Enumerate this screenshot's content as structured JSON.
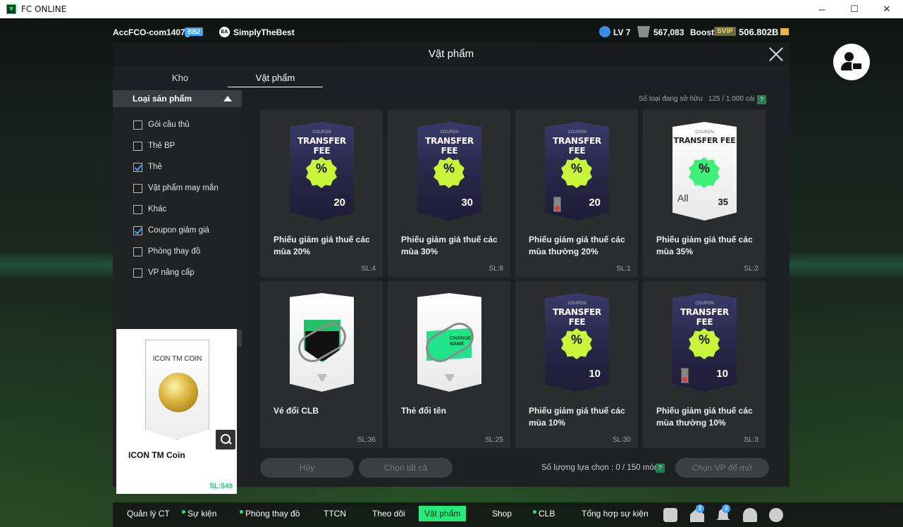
{
  "window": {
    "title": "FC ONLINE",
    "minimize": "─",
    "maximize": "☐",
    "close": "✕"
  },
  "topbar": {
    "account": "AccFCO-com1407g",
    "account_badge": "BB2",
    "ea_label": "EA",
    "team": "SimplyTheBest",
    "level": "LV 7",
    "coins": "567,083",
    "boost_label": "Boost",
    "svip": "SVIP",
    "bp": "506.802B"
  },
  "panel": {
    "title": "Vật phẩm",
    "tabs": [
      {
        "label": "Kho"
      },
      {
        "label": "Vật phẩm"
      }
    ],
    "category_header": "Loại sản phẩm",
    "categories": [
      {
        "label": "Gói cầu thủ",
        "checked": false
      },
      {
        "label": "Thẻ BP",
        "checked": false
      },
      {
        "label": "Thẻ",
        "checked": true
      },
      {
        "label": "Vật phẩm may mắn",
        "checked": false
      },
      {
        "label": "Khác",
        "checked": false
      },
      {
        "label": "Coupon giảm giá",
        "checked": true
      },
      {
        "label": "Phòng thay đồ",
        "checked": false
      },
      {
        "label": "VP nâng cấp",
        "checked": false
      }
    ],
    "detail": {
      "card_title": "ICON TM COIN",
      "name": "ICON TM Coin",
      "qty": "SL:549"
    },
    "count_label": "Số loại đang sở hữu",
    "count_value": "125 / 1.000 cái",
    "help": "?",
    "items": [
      {
        "name": "Phiếu giảm giá thuế các mùa 20%",
        "qty": "SL:4",
        "card": "coupon",
        "small": "COUPON",
        "title": "TRANSFER FEE",
        "pct": "20",
        "restricted": false
      },
      {
        "name": "Phiếu giảm giá thuế các mùa 30%",
        "qty": "SL:8",
        "card": "coupon",
        "small": "COUPON",
        "title": "TRANSFER FEE",
        "pct": "30",
        "restricted": false
      },
      {
        "name": "Phiếu giảm giá thuế các mùa thường 20%",
        "qty": "SL:1",
        "card": "coupon",
        "small": "COUPON",
        "title": "TRANSFER FEE",
        "pct": "20",
        "restricted": true
      },
      {
        "name": "Phiếu giảm giá thuế các mùa 35%",
        "qty": "SL:2",
        "card": "coupon-white",
        "small": "COUPON",
        "title": "TRANSFER FEE",
        "pct": "35",
        "all": "All",
        "restricted": false
      },
      {
        "name": "Vé đổi CLB",
        "qty": "SL:36",
        "card": "club",
        "restricted": false
      },
      {
        "name": "Thẻ đổi tên",
        "qty": "SL:25",
        "card": "rename",
        "change_text": "CHANGE NAME",
        "restricted": false
      },
      {
        "name": "Phiếu giảm giá thuế các mùa 10%",
        "qty": "SL:30",
        "card": "coupon",
        "small": "COUPON",
        "title": "TRANSFER FEE",
        "pct": "10",
        "restricted": false
      },
      {
        "name": "Phiếu giảm giá thuế các mùa thường 10%",
        "qty": "SL:3",
        "card": "coupon",
        "small": "COUPON",
        "title": "TRANSFER FEE",
        "pct": "10",
        "restricted": true
      }
    ],
    "buttons": {
      "cancel": "Hủy",
      "select_all": "Chọn tất cả",
      "confirm": "Chọn VP để mở"
    },
    "selection_label": "Số lượng lựa chọn : 0 / 150 món"
  },
  "bottomnav": {
    "items": [
      {
        "label": "Quản lý CT",
        "dot": false
      },
      {
        "label": "Sự kiện",
        "dot": true
      },
      {
        "label": "Phòng thay đồ",
        "dot": true
      },
      {
        "label": "TTCN",
        "dot": false
      },
      {
        "label": "Theo dõi",
        "dot": false
      },
      {
        "label": "Vật phẩm",
        "dot": false,
        "active": true
      },
      {
        "label": "Shop",
        "dot": false
      },
      {
        "label": "CLB",
        "dot": true
      },
      {
        "label": "Tổng hợp sự kiện",
        "dot": false
      }
    ],
    "badges": {
      "home": "2",
      "notifications": "3"
    }
  },
  "colors": {
    "accent": "#28ea7a",
    "badge_blue": "#3ea6ff",
    "coupon_badge": "#c8f53a"
  }
}
